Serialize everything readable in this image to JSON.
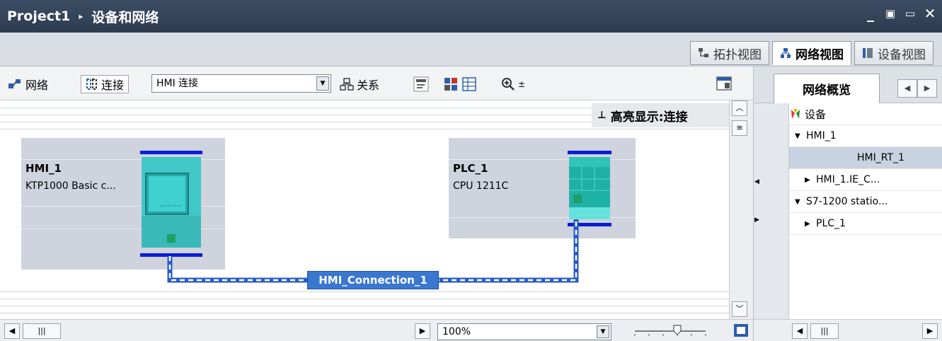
{
  "titlebar": {
    "project": "Project1",
    "separator": "▸",
    "section": "设备和网络",
    "controls": [
      "_",
      "▣",
      "▭",
      "✕"
    ]
  },
  "view_tabs": [
    {
      "label": "拓扑视图",
      "icon": "topology-icon",
      "active": false
    },
    {
      "label": "网络视图",
      "icon": "network-icon",
      "active": true
    },
    {
      "label": "设备视图",
      "icon": "device-icon",
      "active": false
    }
  ],
  "toolbar": {
    "network_label": "网络",
    "connect_label": "连接",
    "connection_type": "HMI 连接",
    "relation_label": "关系",
    "zoom_glyph": "⊕"
  },
  "canvas": {
    "highlight_label": "高亮显示:连接",
    "pin_glyph": "ꟷ",
    "devices": [
      {
        "name": "HMI_1",
        "type": "KTP1000 Basic c..."
      },
      {
        "name": "PLC_1",
        "type": "CPU 1211C"
      }
    ],
    "connection_label": "HMI_Connection_1"
  },
  "bottombar": {
    "zoom_value": "100%"
  },
  "right_panel": {
    "tab_label": "网络概览",
    "column_header": "设备",
    "tree": [
      {
        "label": "HMI_1",
        "level": 1,
        "expander": "▼"
      },
      {
        "label": "HMI_RT_1",
        "level": 3,
        "expander": "",
        "selected": true
      },
      {
        "label": "HMI_1.IE_C...",
        "level": 2,
        "expander": "▶"
      },
      {
        "label": "S7-1200 statio...",
        "level": 1,
        "expander": "▼"
      },
      {
        "label": "PLC_1",
        "level": 2,
        "expander": "▶"
      }
    ]
  },
  "colors": {
    "title_bg": "#34465c",
    "device_box": "#cfd3de",
    "device_module": "#40c8c8",
    "bus_line": "#0a1ed6",
    "connection": "#3a78d0"
  }
}
